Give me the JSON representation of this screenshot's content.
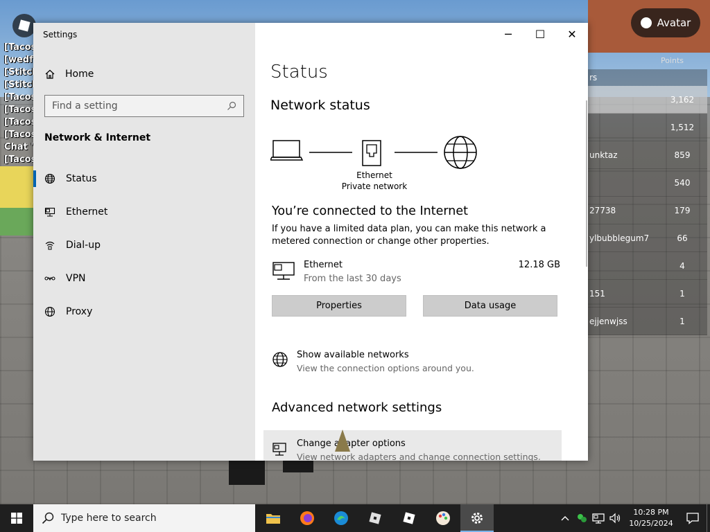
{
  "game": {
    "chat_lines": [
      "[Tacos",
      "[wedf",
      "[Stitch",
      "[Stitch",
      "[Tacos",
      "[Tacos",
      "[Tacos",
      "[Tacos",
      "Chat '",
      "[Tacos"
    ],
    "avatar_button": "Avatar",
    "leaderboard": {
      "header": "Points",
      "title": "rs",
      "rows": [
        {
          "name": "",
          "points": "3,162"
        },
        {
          "name": "",
          "points": "1,512"
        },
        {
          "name": "unktaz",
          "points": "859"
        },
        {
          "name": "",
          "points": "540"
        },
        {
          "name": "27738",
          "points": "179"
        },
        {
          "name": "ylbubblegum7",
          "points": "66"
        },
        {
          "name": "",
          "points": "4"
        },
        {
          "name": "151",
          "points": "1"
        },
        {
          "name": "ejjenwjss",
          "points": "1"
        }
      ]
    }
  },
  "window": {
    "title": "Settings",
    "controls": {
      "minimize": "─",
      "maximize": "☐",
      "close": "✕"
    }
  },
  "nav": {
    "home": "Home",
    "search_placeholder": "Find a setting",
    "section": "Network & Internet",
    "items": [
      {
        "label": "Status",
        "icon": "globe-icon",
        "selected": true
      },
      {
        "label": "Ethernet",
        "icon": "ethernet-icon",
        "selected": false
      },
      {
        "label": "Dial-up",
        "icon": "dialup-icon",
        "selected": false
      },
      {
        "label": "VPN",
        "icon": "vpn-icon",
        "selected": false
      },
      {
        "label": "Proxy",
        "icon": "globe-icon",
        "selected": false
      }
    ]
  },
  "content": {
    "page_title": "Status",
    "network_status_heading": "Network status",
    "connection_name": "Ethernet",
    "connection_profile": "Private network",
    "connected_heading": "You’re connected to the Internet",
    "metered_text": "If you have a limited data plan, you can make this network a metered connection or change other properties.",
    "ethernet": {
      "name": "Ethernet",
      "period": "From the last 30 days",
      "usage": "12.18 GB"
    },
    "buttons": {
      "properties": "Properties",
      "data_usage": "Data usage"
    },
    "show_networks": {
      "title": "Show available networks",
      "desc": "View the connection options around you."
    },
    "advanced_heading": "Advanced network settings",
    "change_adapter": {
      "title": "Change adapter options",
      "desc": "View network adapters and change connection settings."
    }
  },
  "taskbar": {
    "search_placeholder": "Type here to search",
    "apps": [
      "file-explorer-icon",
      "firefox-icon",
      "edge-icon",
      "roblox-icon",
      "roblox-studio-icon",
      "paint-icon",
      "settings-icon"
    ],
    "time": "10:28 PM",
    "date": "10/25/2024"
  }
}
